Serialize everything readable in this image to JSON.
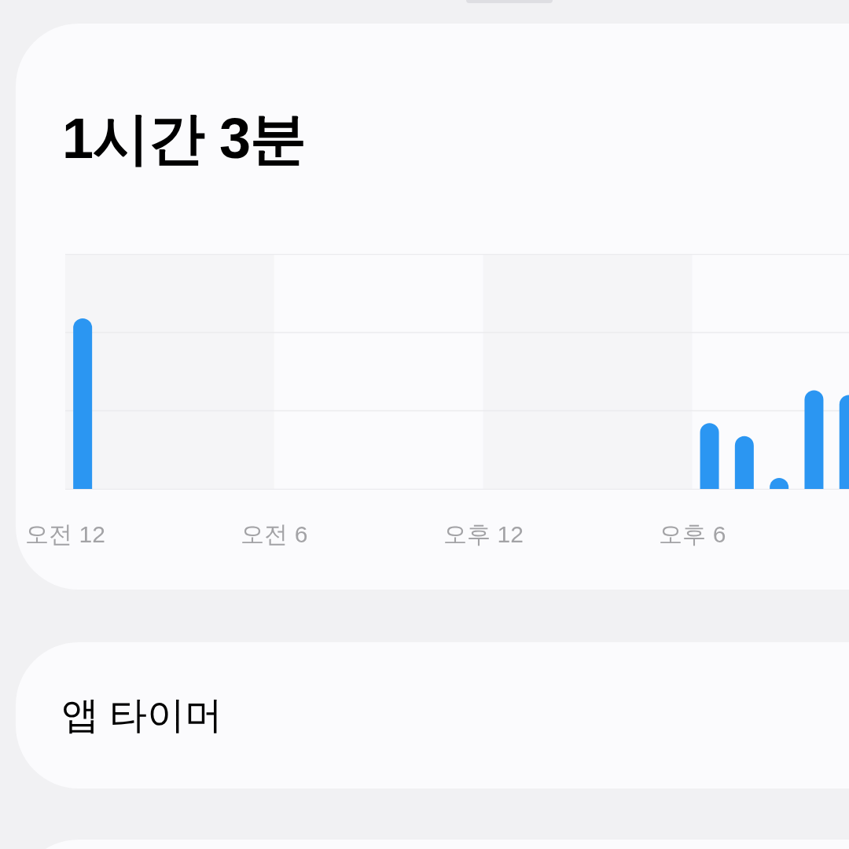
{
  "summary_card": {
    "total_time": "1시간 3분",
    "chart": {
      "x_labels": [
        "오전 12",
        "오전 6",
        "오후 12",
        "오후 6"
      ]
    }
  },
  "app_timer_card": {
    "title": "앱 타이머"
  }
}
